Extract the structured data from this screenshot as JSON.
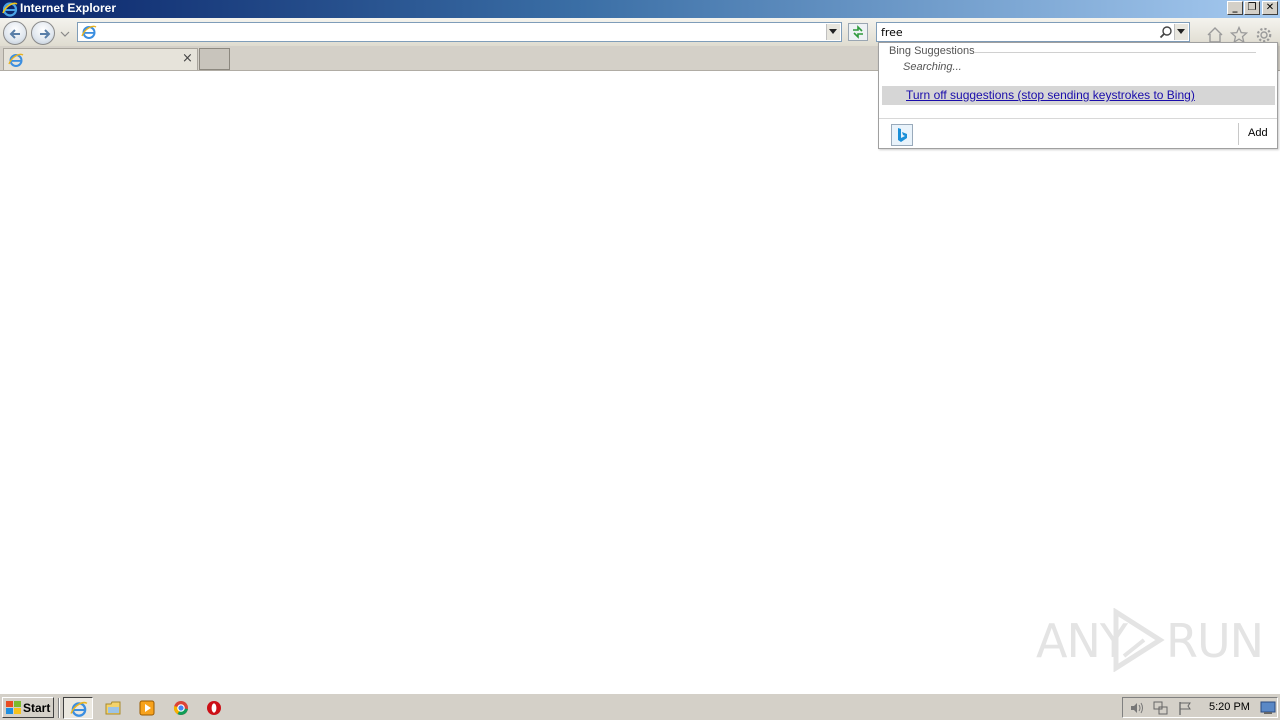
{
  "window": {
    "title": "Internet Explorer",
    "minimize_glyph": "_",
    "restore_glyph": "❐",
    "close_glyph": "✕"
  },
  "navbar": {
    "address_value": "",
    "search_value": "free "
  },
  "tab": {
    "title": "",
    "close_glyph": "×"
  },
  "suggestions": {
    "header": "Bing Suggestions",
    "status": "Searching...",
    "turn_off_link": "Turn off suggestions (stop sending keystrokes to Bing)",
    "add_label": "Add"
  },
  "watermark": {
    "left": "ANY",
    "right": "RUN"
  },
  "taskbar": {
    "start_label": "Start",
    "clock": "5:20 PM",
    "apps": [
      "internet-explorer",
      "file-explorer",
      "media-player",
      "chrome",
      "opera"
    ]
  }
}
